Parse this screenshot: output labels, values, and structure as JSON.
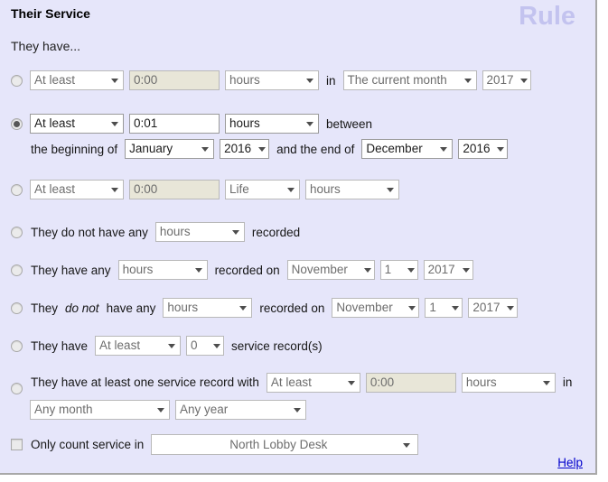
{
  "panel": {
    "title": "Their Service",
    "subtitle": "They have...",
    "watermark": "Rule"
  },
  "options": [
    {
      "id": "hours-in-period",
      "selected": false,
      "enabled": false,
      "comparator": "At least",
      "amount": "0:00",
      "unit": "hours",
      "in_label": "in",
      "period": "The current month",
      "year": "2017"
    },
    {
      "id": "hours-between-dates",
      "selected": true,
      "enabled": true,
      "comparator": "At least",
      "amount": "0:01",
      "unit": "hours",
      "between_label": "between",
      "beginning_label": "the beginning of",
      "start_month": "January",
      "start_year": "2016",
      "end_label": "and the end of",
      "end_month": "December",
      "end_year": "2016"
    },
    {
      "id": "hours-life",
      "selected": false,
      "enabled": false,
      "comparator": "At least",
      "amount": "0:00",
      "scope": "Life",
      "unit": "hours"
    },
    {
      "id": "no-hours-recorded",
      "selected": false,
      "enabled": false,
      "prefix": "They do not have any",
      "unit": "hours",
      "suffix": "recorded"
    },
    {
      "id": "any-hours-on-date",
      "selected": false,
      "enabled": false,
      "prefix": "They have any",
      "unit": "hours",
      "mid": "recorded on",
      "month": "November",
      "day": "1",
      "year": "2017"
    },
    {
      "id": "no-hours-on-date",
      "selected": false,
      "enabled": false,
      "prefix_a": "They",
      "prefix_em": "do not",
      "prefix_b": "have any",
      "unit": "hours",
      "mid": "recorded on",
      "month": "November",
      "day": "1",
      "year": "2017"
    },
    {
      "id": "service-record-count",
      "selected": false,
      "enabled": false,
      "prefix": "They have",
      "comparator": "At least",
      "count": "0",
      "suffix": "service record(s)"
    },
    {
      "id": "service-record-with-hours",
      "selected": false,
      "enabled": false,
      "prefix": "They have at least one service record with",
      "comparator": "At least",
      "amount": "0:00",
      "unit": "hours",
      "in_label": "in",
      "month": "Any month",
      "year": "Any year"
    }
  ],
  "footer": {
    "only_count_checked": false,
    "only_count_label": "Only count service in",
    "location": "North Lobby Desk",
    "help_label": "Help"
  },
  "colors": {
    "panel_bg": "#e6e6fa",
    "watermark": "#c3c3ef",
    "link": "#0000cc",
    "disabled_text": "#6d6d6d",
    "disabled_input_bg": "#e8e6d8"
  }
}
